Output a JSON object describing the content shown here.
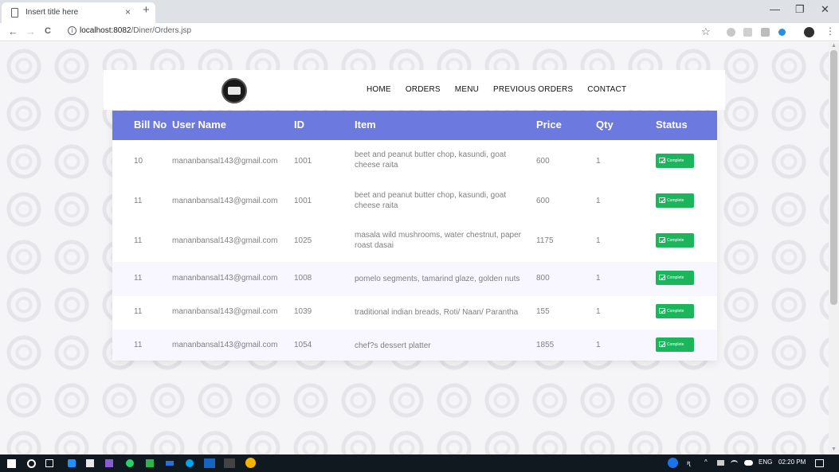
{
  "browser": {
    "tab_title": "Insert title here",
    "tab_close": "×",
    "new_tab": "+",
    "minimize": "—",
    "maximize": "❐",
    "close": "✕",
    "back": "←",
    "forward": "→",
    "reload": "C",
    "url_host": "localhost:8082",
    "url_path": "/Diner/Orders.jsp",
    "star": "☆",
    "menu": "⋮"
  },
  "nav": {
    "home": "HOME",
    "orders": "ORDERS",
    "menu": "MENU",
    "previous_orders": "PREVIOUS ORDERS",
    "contact": "CONTACT"
  },
  "table": {
    "headers": {
      "bill_no": "Bill No",
      "user_name": "User Name",
      "id": "ID",
      "item": "Item",
      "price": "Price",
      "qty": "Qty",
      "status": "Status"
    },
    "status_label": "Complete",
    "rows": [
      {
        "bill": "10",
        "user": "mananbansal143@gmail.com",
        "id": "1001",
        "item": "beet and peanut butter chop, kasundi, goat cheese raita",
        "price": "600",
        "qty": "1"
      },
      {
        "bill": "11",
        "user": "mananbansal143@gmail.com",
        "id": "1001",
        "item": "beet and peanut butter chop, kasundi, goat cheese raita",
        "price": "600",
        "qty": "1"
      },
      {
        "bill": "11",
        "user": "mananbansal143@gmail.com",
        "id": "1025",
        "item": "masala wild mushrooms, water chestnut, paper roast dasai",
        "price": "1175",
        "qty": "1"
      },
      {
        "bill": "11",
        "user": "mananbansal143@gmail.com",
        "id": "1008",
        "item": "pomelo segments, tamarind glaze, golden nuts",
        "price": "800",
        "qty": "1"
      },
      {
        "bill": "11",
        "user": "mananbansal143@gmail.com",
        "id": "1039",
        "item": "traditional indian breads, Roti/ Naan/ Parantha",
        "price": "155",
        "qty": "1"
      },
      {
        "bill": "11",
        "user": "mananbansal143@gmail.com",
        "id": "1054",
        "item": "chef?s dessert platter",
        "price": "1855",
        "qty": "1"
      }
    ]
  },
  "taskbar": {
    "lang": "ENG",
    "time": "02:20 PM"
  },
  "colors": {
    "header_bg": "#6c7ae0",
    "status_green": "#1bb55c",
    "alt_row": "#f8f6ff"
  },
  "icons": [
    "windows-start-icon",
    "search-icon",
    "task-view-icon",
    "chrome-icon",
    "shield-icon",
    "help-icon",
    "wifi-icon",
    "cloud-icon",
    "notification-icon"
  ]
}
